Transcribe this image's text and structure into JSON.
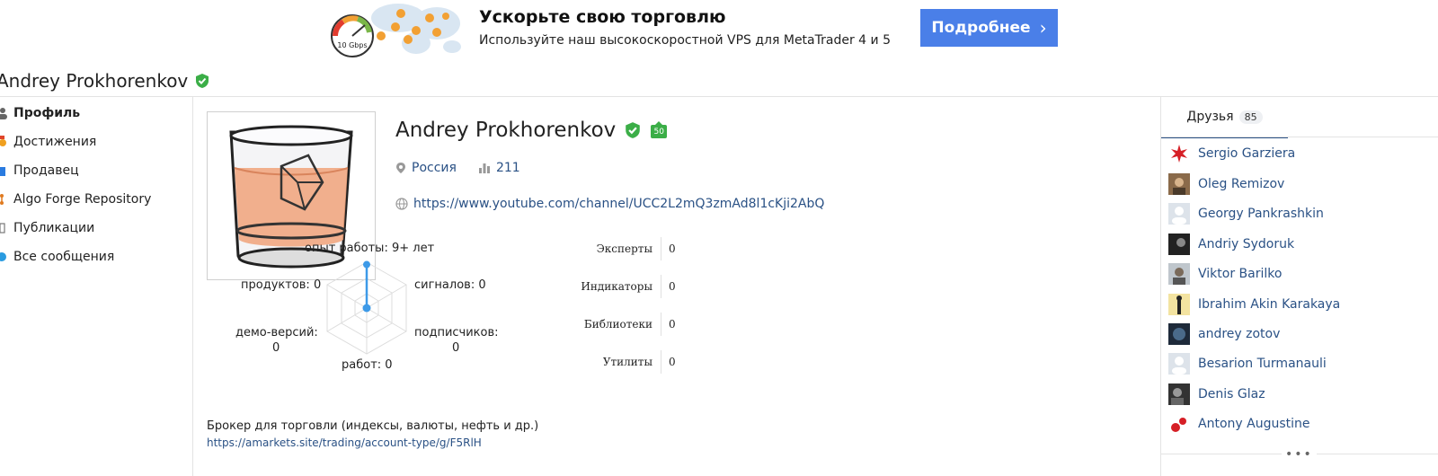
{
  "banner": {
    "speed_badge": "10 Gbps",
    "title": "Ускорьте свою торговлю",
    "subtitle": "Используйте наш высокоскоростной VPS для MetaTrader 4 и 5",
    "button_label": "Подробнее",
    "button_color": "#4a7fe8"
  },
  "header": {
    "title": "Andrey Prokhorenkov"
  },
  "sidebar": {
    "items": [
      {
        "label": "Профиль",
        "icon": "user-icon",
        "active": true
      },
      {
        "label": "Достижения",
        "icon": "medal-icon"
      },
      {
        "label": "Продавец",
        "icon": "shop-icon"
      },
      {
        "label": "Algo Forge Repository",
        "icon": "repo-icon"
      },
      {
        "label": "Публикации",
        "icon": "document-icon"
      },
      {
        "label": "Все сообщения",
        "icon": "message-icon"
      }
    ]
  },
  "profile": {
    "name": "Andrey Prokhorenkov",
    "badge_level": "50",
    "country": "Россия",
    "rating": "211",
    "url": "https://www.youtube.com/channel/UCC2L2mQ3zmAd8l1cKji2AbQ",
    "broker_text": "Брокер для торговли (индексы, валюты, нефть и др.)",
    "broker_link": "https://amarkets.site/trading/account-type/g/F5RlH"
  },
  "radar": {
    "labels": {
      "experience": "опыт работы: 9+ лет",
      "products": "продуктов: 0",
      "signals": "сигналов: 0",
      "demos_label": "демо-версий:",
      "demos_value": "0",
      "subscribers_label": "подписчиков:",
      "subscribers_value": "0",
      "jobs": "работ: 0"
    },
    "experience_level": 0.95,
    "accent": "#3d9ae8"
  },
  "products": [
    {
      "label": "Эксперты",
      "value": "0"
    },
    {
      "label": "Индикаторы",
      "value": "0"
    },
    {
      "label": "Библиотеки",
      "value": "0"
    },
    {
      "label": "Утилиты",
      "value": "0"
    }
  ],
  "friends": {
    "tab_label": "Друзья",
    "count": "85",
    "more": "•••",
    "list": [
      {
        "name": "Sergio Garziera"
      },
      {
        "name": "Oleg Remizov"
      },
      {
        "name": "Georgy Pankrashkin"
      },
      {
        "name": "Andriy Sydoruk"
      },
      {
        "name": "Viktor Barilko"
      },
      {
        "name": "Ibrahim Akin Karakaya"
      },
      {
        "name": "andrey zotov"
      },
      {
        "name": "Besarion Turmanauli"
      },
      {
        "name": "Denis Glaz"
      },
      {
        "name": "Antony Augustine"
      }
    ]
  }
}
